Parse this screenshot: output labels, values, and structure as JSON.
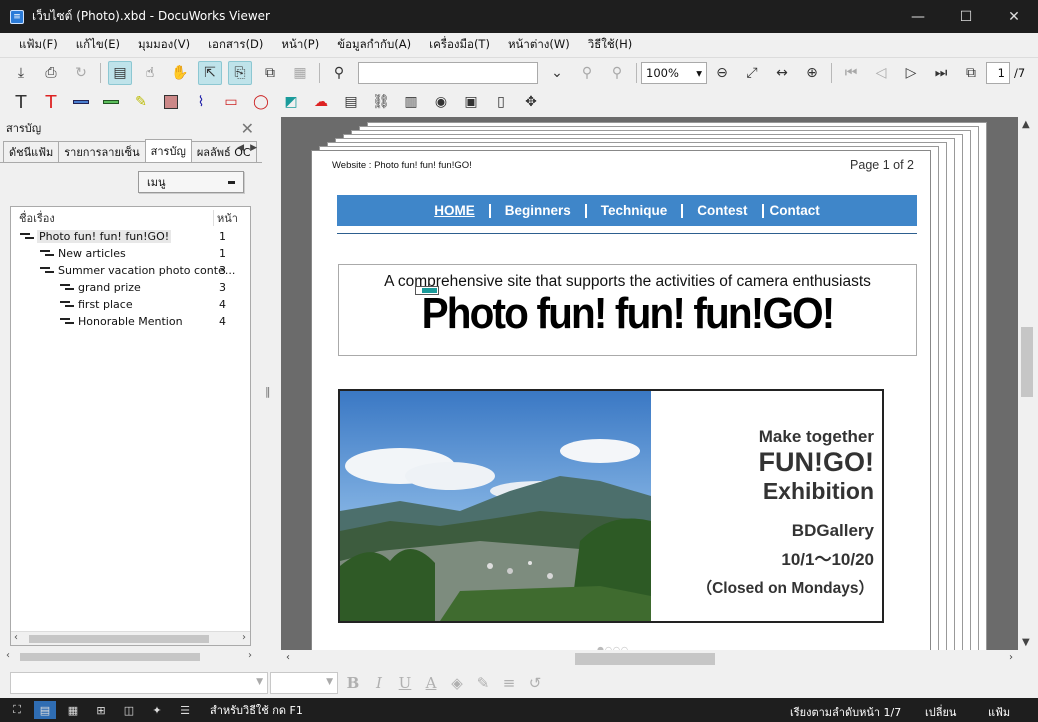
{
  "window": {
    "title": "เว็บไซต์ (Photo).xbd - DocuWorks Viewer",
    "buttons": [
      "—",
      "☐",
      "✕"
    ]
  },
  "menu": [
    "แฟ้ม(F)",
    "แก้ไข(E)",
    "มุมมอง(V)",
    "เอกสาร(D)",
    "หน้า(P)",
    "ข้อมูลกำกับ(A)",
    "เครื่องมือ(T)",
    "หน้าต่าง(W)",
    "วิธีใช้(H)"
  ],
  "toolbar": {
    "zoom": "100%",
    "page_current": "1",
    "page_total": "/7",
    "search_value": ""
  },
  "sidebar": {
    "title": "สารบัญ",
    "tabs": [
      "ดัชนีแฟ้ม",
      "รายการลายเซ็น",
      "สารบัญ",
      "ผลลัพธ์ OC"
    ],
    "active_tab": "สารบัญ",
    "menu_button": "เมนู",
    "col_title": "ชื่อเรื่อง",
    "col_page": "หน้า",
    "toc": [
      {
        "label": "Photo fun! fun! fun!GO!",
        "page": "1",
        "level": 0
      },
      {
        "label": "New articles",
        "page": "1",
        "level": 1
      },
      {
        "label": "Summer vacation photo conte...",
        "page": "3",
        "level": 1
      },
      {
        "label": "grand prize",
        "page": "3",
        "level": 2
      },
      {
        "label": "first place",
        "page": "4",
        "level": 2
      },
      {
        "label": "Honorable Mention",
        "page": "4",
        "level": 2
      }
    ]
  },
  "document": {
    "header_left": "Website : Photo fun! fun! fun!GO!",
    "header_right": "Page 1 of 2",
    "nav": [
      "HOME",
      "Beginners",
      "Technique",
      "Contest",
      "Contact"
    ],
    "subtitle": "A comprehensive site that supports the activities of camera enthusiasts",
    "site_title": "Photo fun! fun! fun!GO!",
    "banner": {
      "line1": "Make together",
      "line2": "FUN!GO!",
      "line3": "Exhibition",
      "line4": "BDGallery",
      "line5": "10/1～10/20",
      "line6": "（Closed on Mondays）"
    },
    "carousel_dots": "●○○○"
  },
  "statusbar": {
    "help": "สำหรับวิธีใช้ กด F1",
    "order": "เรียงตามลำดับหน้า 1/7",
    "mode": "เปลี่ยน",
    "file": "แฟ้ม"
  },
  "colors": {
    "nav_blue": "#3f86c9",
    "titlebar": "#1e1e1e",
    "viewer_bg": "#6b6b6b",
    "active_tool": "#bfe3ea"
  }
}
